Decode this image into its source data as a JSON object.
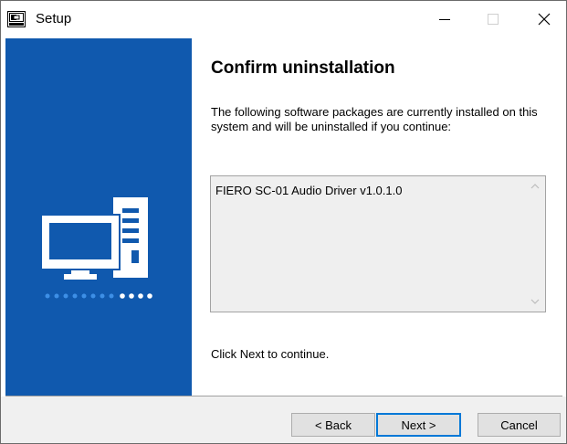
{
  "window": {
    "title": "Setup"
  },
  "titlebar": {
    "app_icon": "setup-app-icon",
    "minimize_icon": "minimize-icon",
    "maximize_icon": "maximize-icon",
    "close_icon": "close-icon"
  },
  "side_panel": {
    "background_color": "#1059ae",
    "illustration": "computer-icon"
  },
  "main": {
    "heading": "Confirm uninstallation",
    "description": "The following software packages are currently installed on this system and will be uninstalled if you continue:",
    "packages": [
      "FIERO SC-01 Audio Driver v1.0.1.0"
    ],
    "footer_hint": "Click Next to continue."
  },
  "buttons": {
    "back": "< Back",
    "next": "Next >",
    "cancel": "Cancel"
  },
  "colors": {
    "accent": "#0078d7"
  }
}
